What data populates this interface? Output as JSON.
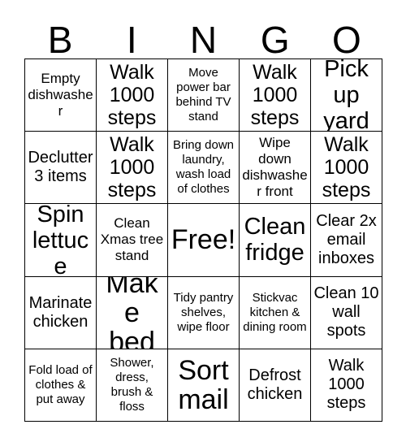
{
  "card": {
    "header_letters": [
      "B",
      "I",
      "N",
      "G",
      "O"
    ],
    "rows": [
      [
        {
          "text": "Empty dishwasher",
          "size": "sm"
        },
        {
          "text": "Walk 1000 steps",
          "size": "lg"
        },
        {
          "text": "Move power bar behind TV stand",
          "size": "xs"
        },
        {
          "text": "Walk 1000 steps",
          "size": "lg"
        },
        {
          "text": "Pick up yard",
          "size": "xl"
        }
      ],
      [
        {
          "text": "Declutter 3 items",
          "size": "md"
        },
        {
          "text": "Walk 1000 steps",
          "size": "lg"
        },
        {
          "text": "Bring down laundry, wash load of clothes",
          "size": "xs"
        },
        {
          "text": "Wipe down dishwasher front",
          "size": "sm"
        },
        {
          "text": "Walk 1000 steps",
          "size": "lg"
        }
      ],
      [
        {
          "text": "Spin lettuce",
          "size": "xl"
        },
        {
          "text": "Clean Xmas tree stand",
          "size": "sm"
        },
        {
          "text": "Free!",
          "size": "xxl"
        },
        {
          "text": "Clean fridge",
          "size": "xl"
        },
        {
          "text": "Clear 2x email inboxes",
          "size": "md"
        }
      ],
      [
        {
          "text": "Marinate chicken",
          "size": "md"
        },
        {
          "text": "Make bed",
          "size": "xxl"
        },
        {
          "text": "Tidy pantry shelves, wipe floor",
          "size": "xs"
        },
        {
          "text": "Stickvac kitchen & dining room",
          "size": "xs"
        },
        {
          "text": "Clean 10 wall spots",
          "size": "md"
        }
      ],
      [
        {
          "text": "Fold load of clothes & put away",
          "size": "xs"
        },
        {
          "text": "Shower, dress, brush & floss",
          "size": "xs"
        },
        {
          "text": "Sort mail",
          "size": "xxl"
        },
        {
          "text": "Defrost chicken",
          "size": "md"
        },
        {
          "text": "Walk 1000 steps",
          "size": "md"
        }
      ]
    ]
  },
  "colors": {
    "background": "#ffffff",
    "text": "#000000",
    "border": "#000000"
  }
}
